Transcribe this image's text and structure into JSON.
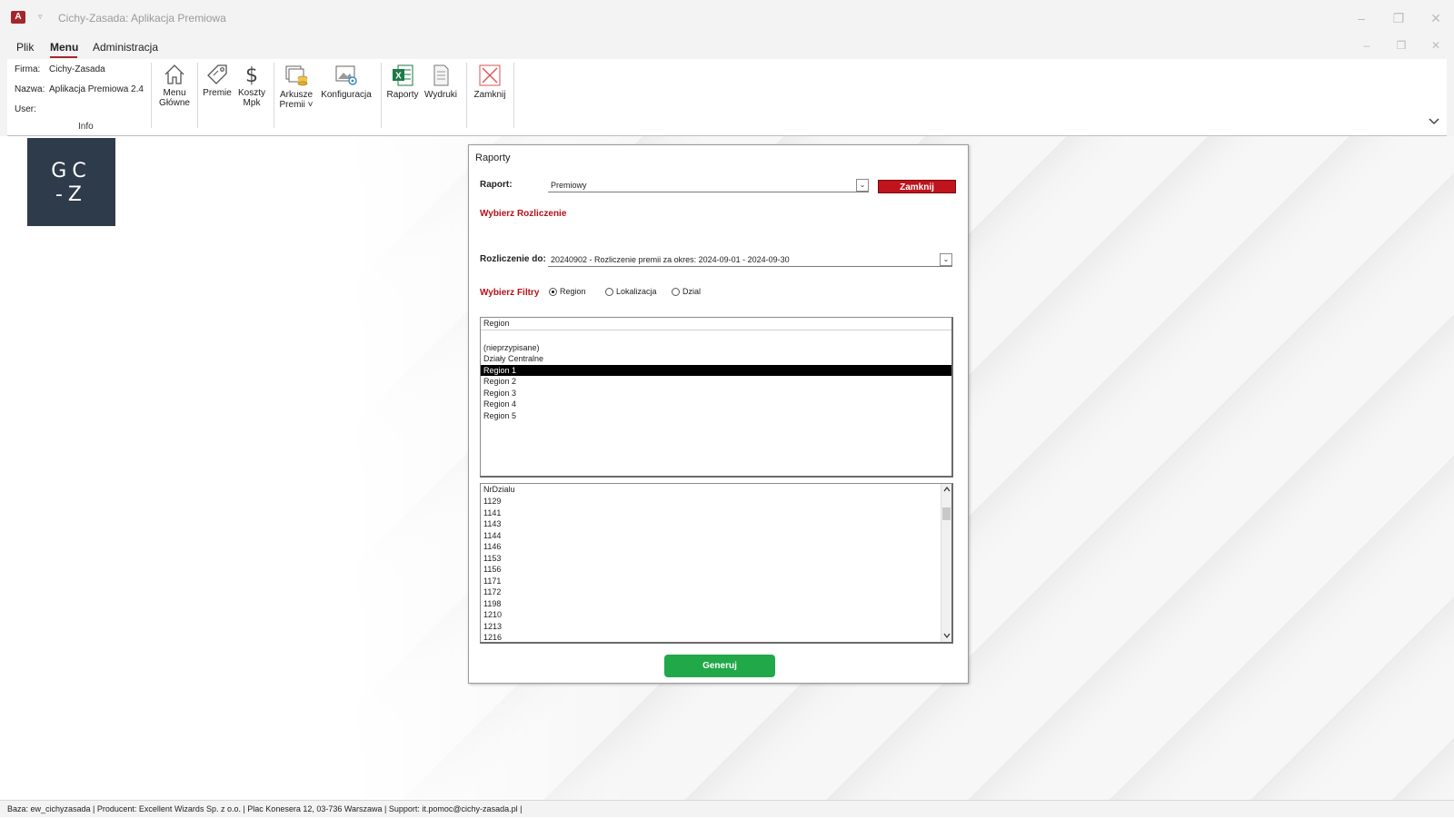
{
  "window": {
    "title": "Cichy-Zasada: Aplikacja Premiowa",
    "app_icon": "A",
    "quick_access": "▿",
    "minimize": "–",
    "restore": "❒",
    "close": "✕"
  },
  "menu": {
    "items": [
      "Plik",
      "Menu",
      "Administracja"
    ],
    "active": "Menu"
  },
  "ribbon": {
    "info": {
      "firma_label": "Firma:",
      "firma_value": "Cichy-Zasada",
      "nazwa_label": "Nazwa:",
      "nazwa_value": "Aplikacja Premiowa 2.4",
      "user_label": "User:",
      "user_value": "",
      "group_caption": "Info"
    },
    "buttons": {
      "menu_glowne": "Menu\nGłówne",
      "premie": "Premie",
      "koszty_mpk": "Koszty\nMpk",
      "arkusze_premii": "Arkusze\nPremii ˅",
      "konfiguracja": "Konfiguracja",
      "raporty": "Raporty",
      "wydruki": "Wydruki",
      "zamknij": "Zamknij"
    },
    "collapse_icon": "chevron-down-icon"
  },
  "logo": {
    "line1": "GC",
    "line2": "-Z"
  },
  "dialog": {
    "title": "Raporty",
    "raport_label": "Raport:",
    "raport_value": "Premiowy",
    "close_button": "Zamknij",
    "wybierz_rozliczenie": "Wybierz Rozliczenie",
    "rozliczenie_label": "Rozliczenie do:",
    "rozliczenie_value": "20240902 - Rozliczenie premii za okres: 2024-09-01 - 2024-09-30",
    "wybierz_filtry": "Wybierz Filtry",
    "filters": {
      "region": "Region",
      "lokalizacja": "Lokalizacja",
      "dzial": "Dzial",
      "selected": "Region"
    },
    "region_list": {
      "header": "Region",
      "items": [
        "",
        "(nieprzypisane)",
        "Działy Centralne",
        "Region 1",
        "Region 2",
        "Region 3",
        "Region 4",
        "Region 5"
      ],
      "selected": "Region 1"
    },
    "dzial_list": {
      "header": "NrDzialu",
      "items": [
        "1129",
        "1141",
        "1143",
        "1144",
        "1146",
        "1153",
        "1156",
        "1171",
        "1172",
        "1198",
        "1210",
        "1213",
        "1216"
      ]
    },
    "generate_button": "Generuj",
    "dropdown_arrow": "⌄"
  },
  "statusbar": {
    "text": "Baza: ew_cichyzasada | Producent: Excellent Wizards Sp. z o.o. | Plac Konesera 12, 03-736 Warszawa | Support: it.pomoc@cichy-zasada.pl |"
  }
}
